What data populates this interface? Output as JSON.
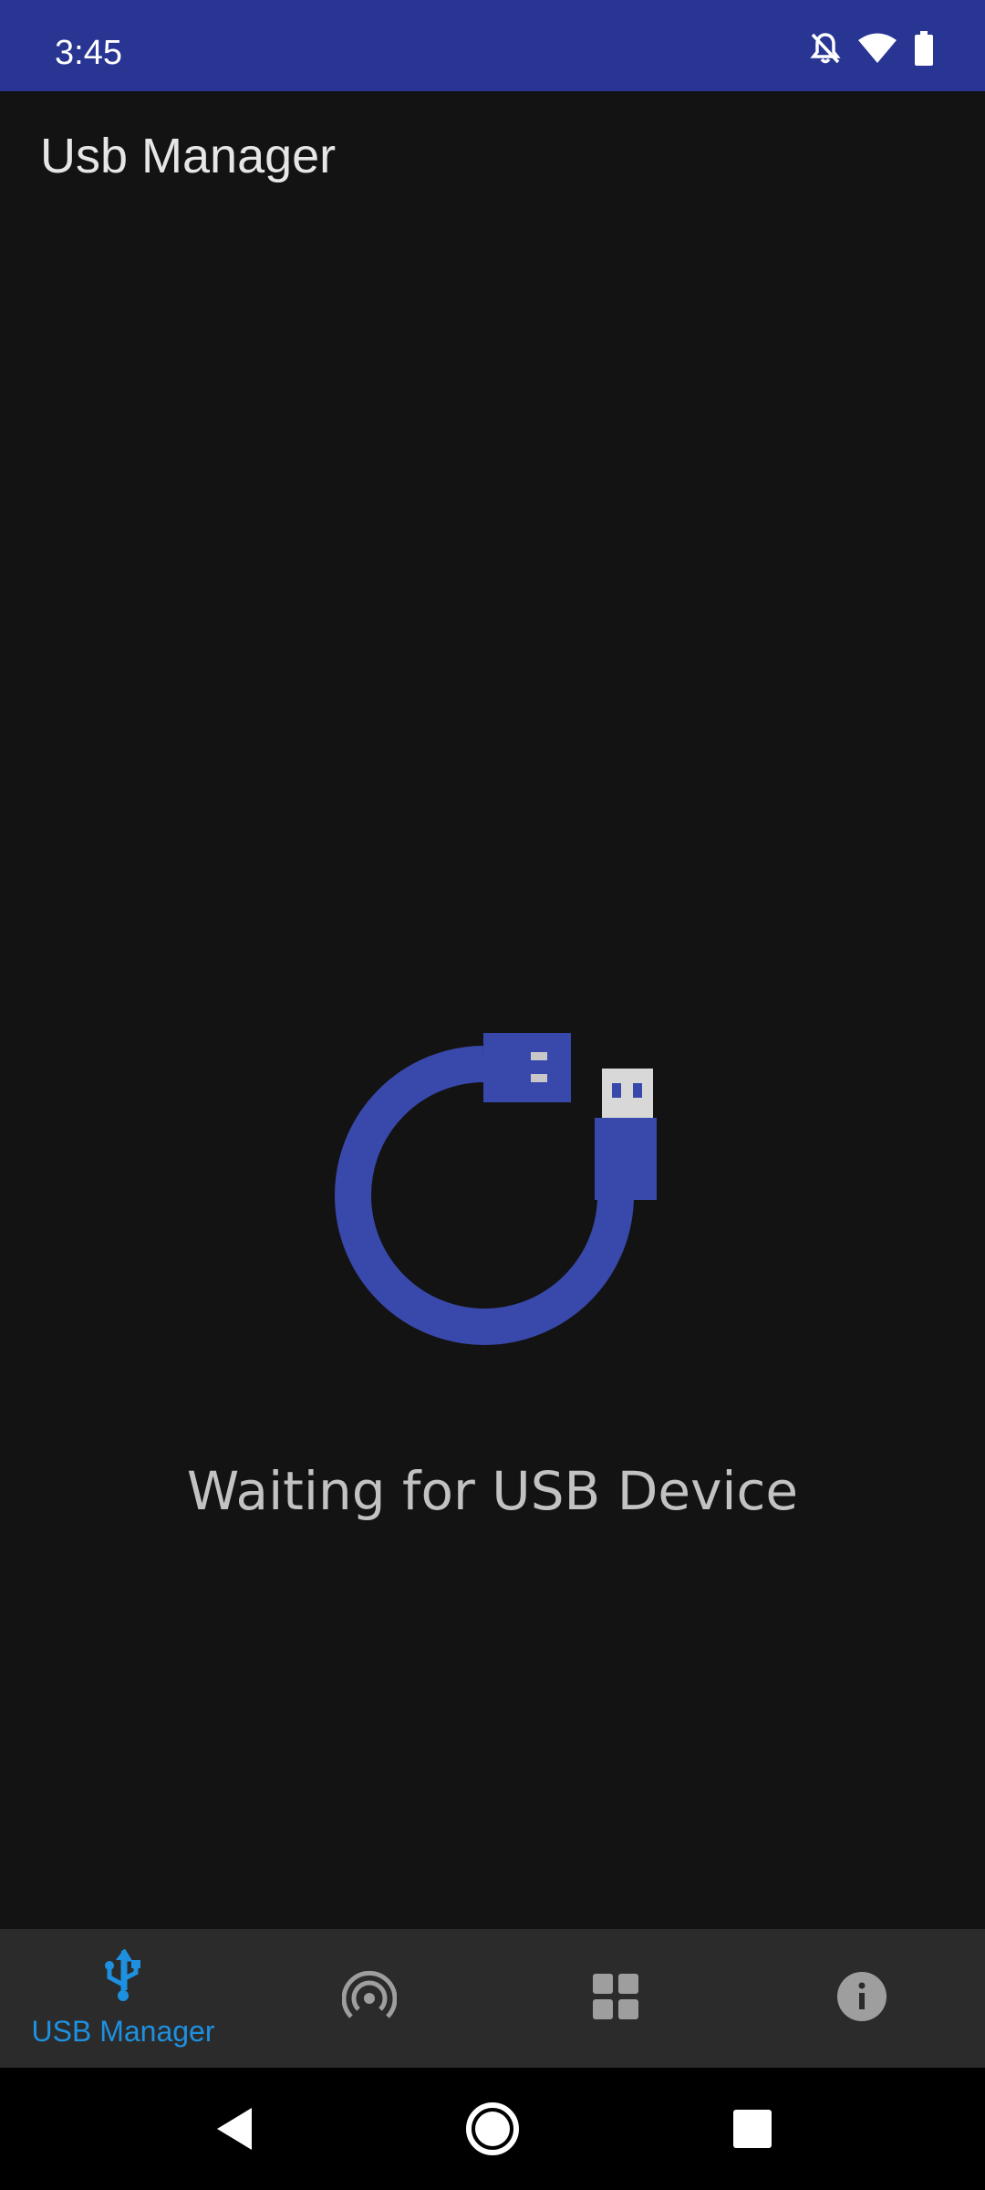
{
  "status_bar": {
    "time": "3:45",
    "icons": [
      "notifications-off-icon",
      "wifi-icon",
      "battery-icon"
    ],
    "background": "#283593"
  },
  "app_bar": {
    "title": "Usb Manager"
  },
  "empty_state": {
    "illustration": "usb-cable-icon",
    "message": "Waiting for USB Device",
    "accent": "#3949AB"
  },
  "bottom_nav": {
    "items": [
      {
        "icon": "usb-icon",
        "label": "USB Manager",
        "selected": true
      },
      {
        "icon": "broadcast-icon",
        "label": "",
        "selected": false
      },
      {
        "icon": "grid-icon",
        "label": "",
        "selected": false
      },
      {
        "icon": "info-icon",
        "label": "",
        "selected": false
      }
    ],
    "selected_color": "#1E90E0",
    "unselected_color": "#9E9E9E"
  },
  "system_nav": {
    "buttons": [
      "back-icon",
      "home-icon",
      "recents-icon"
    ]
  }
}
